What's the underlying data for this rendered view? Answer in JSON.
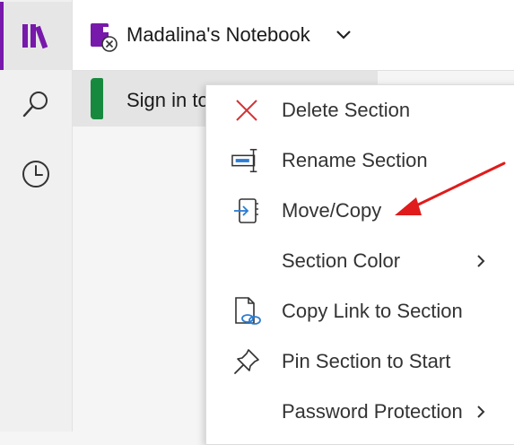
{
  "notebook": {
    "title": "Madalina's Notebook"
  },
  "section": {
    "label": "Sign in to"
  },
  "colors": {
    "accent": "#7719aa",
    "section_tab": "#17893e",
    "delete_x": "#d13438",
    "icon_blue": "#2b7cd3",
    "annotation_arrow": "#e01b1b"
  },
  "rail": {
    "items": [
      {
        "icon": "notebooks-icon"
      },
      {
        "icon": "search-icon"
      },
      {
        "icon": "recent-icon"
      }
    ]
  },
  "context_menu": {
    "items": [
      {
        "label": "Delete Section",
        "icon": "delete-x-icon"
      },
      {
        "label": "Rename Section",
        "icon": "rename-icon"
      },
      {
        "label": "Move/Copy",
        "icon": "move-copy-icon"
      },
      {
        "label": "Section Color",
        "icon": "",
        "submenu": true
      },
      {
        "label": "Copy Link to Section",
        "icon": "copy-link-icon"
      },
      {
        "label": "Pin Section to Start",
        "icon": "pin-icon"
      },
      {
        "label": "Password Protection",
        "icon": "",
        "submenu": true
      }
    ]
  }
}
